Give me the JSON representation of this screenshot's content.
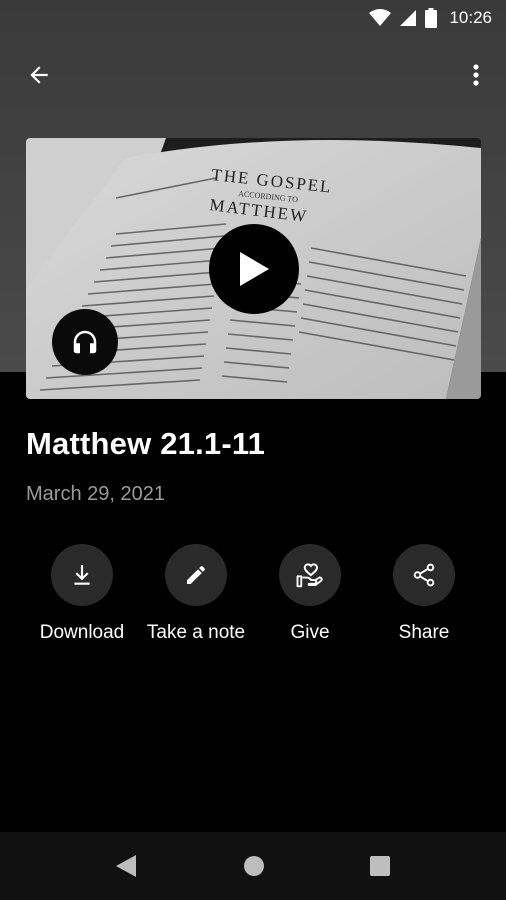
{
  "status_bar": {
    "time": "10:26"
  },
  "app_bar": {
    "back_icon": "arrow-back-icon",
    "menu_icon": "more-vert-icon"
  },
  "media": {
    "book_heading_line1": "THE GOSPEL",
    "book_heading_line2": "ACCORDING TO",
    "book_heading_line3": "MATTHEW",
    "play_icon": "play-icon",
    "audio_icon": "headphones-icon"
  },
  "sermon": {
    "title": "Matthew 21.1-11",
    "date": "March 29, 2021"
  },
  "actions": [
    {
      "label": "Download",
      "icon": "download-icon"
    },
    {
      "label": "Take a note",
      "icon": "pencil-icon"
    },
    {
      "label": "Give",
      "icon": "give-heart-hand-icon"
    },
    {
      "label": "Share",
      "icon": "share-icon"
    }
  ],
  "colors": {
    "background": "#000000",
    "header_bg": "#444444",
    "action_circle": "#2a2a2a",
    "date_text": "#9a9a9a",
    "nav_bar": "#111111"
  }
}
